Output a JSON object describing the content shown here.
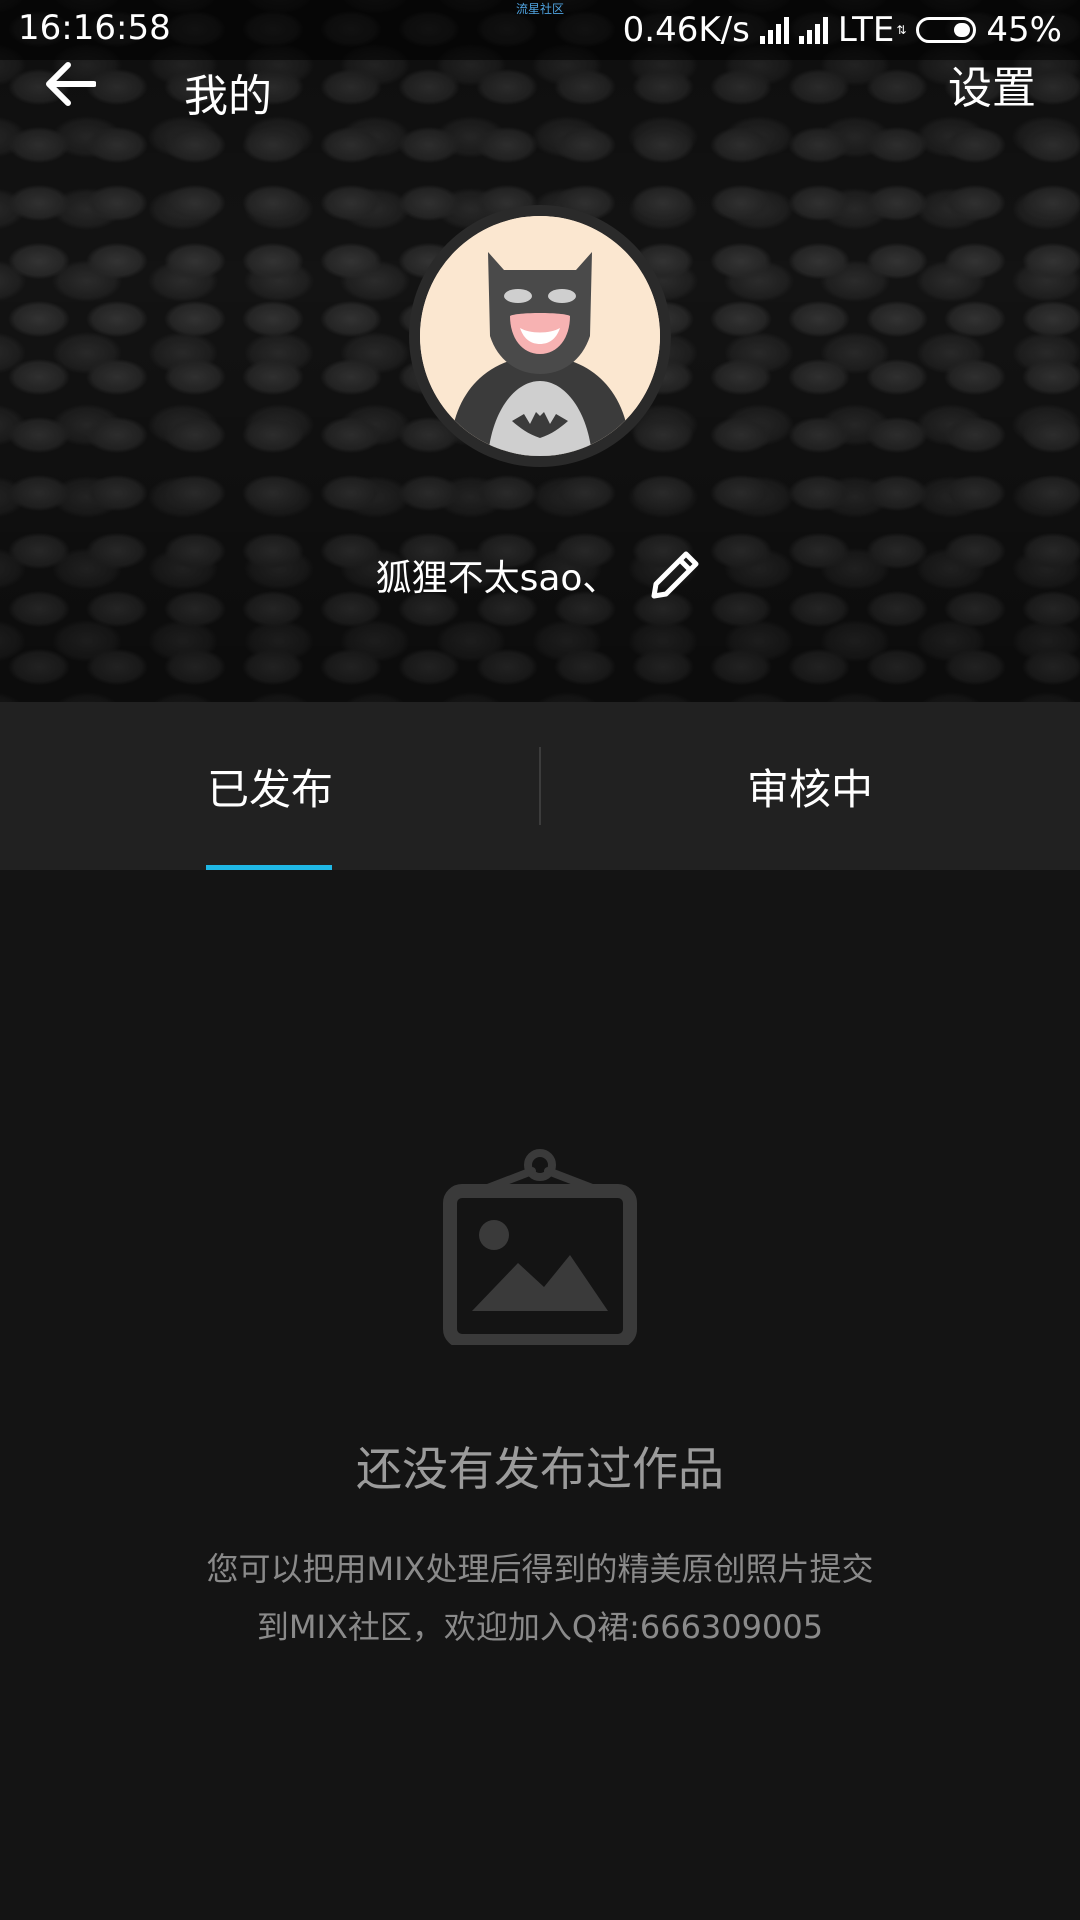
{
  "status_bar": {
    "time": "16:16:58",
    "center_label": "流星社区",
    "network_speed": "0.46K/s",
    "network_type": "LTE",
    "battery": "45%"
  },
  "nav": {
    "back_icon": "arrow-left-icon",
    "title": "我的",
    "settings_label": "设置"
  },
  "profile": {
    "avatar_icon": "batman-avatar",
    "username": "狐狸不太sao、",
    "edit_icon": "pencil-icon"
  },
  "tabs": [
    {
      "label": "已发布",
      "active": true
    },
    {
      "label": "审核中",
      "active": false
    }
  ],
  "empty_state": {
    "icon": "picture-frame-icon",
    "title": "还没有发布过作品",
    "description_line1": "您可以把用MIX处理后得到的精美原创照片提交",
    "description_line2": "到MIX社区，欢迎加入Q裙:666309005"
  },
  "colors": {
    "accent": "#1fb8e6",
    "background": "#141414",
    "tab_bar": "#212121"
  }
}
